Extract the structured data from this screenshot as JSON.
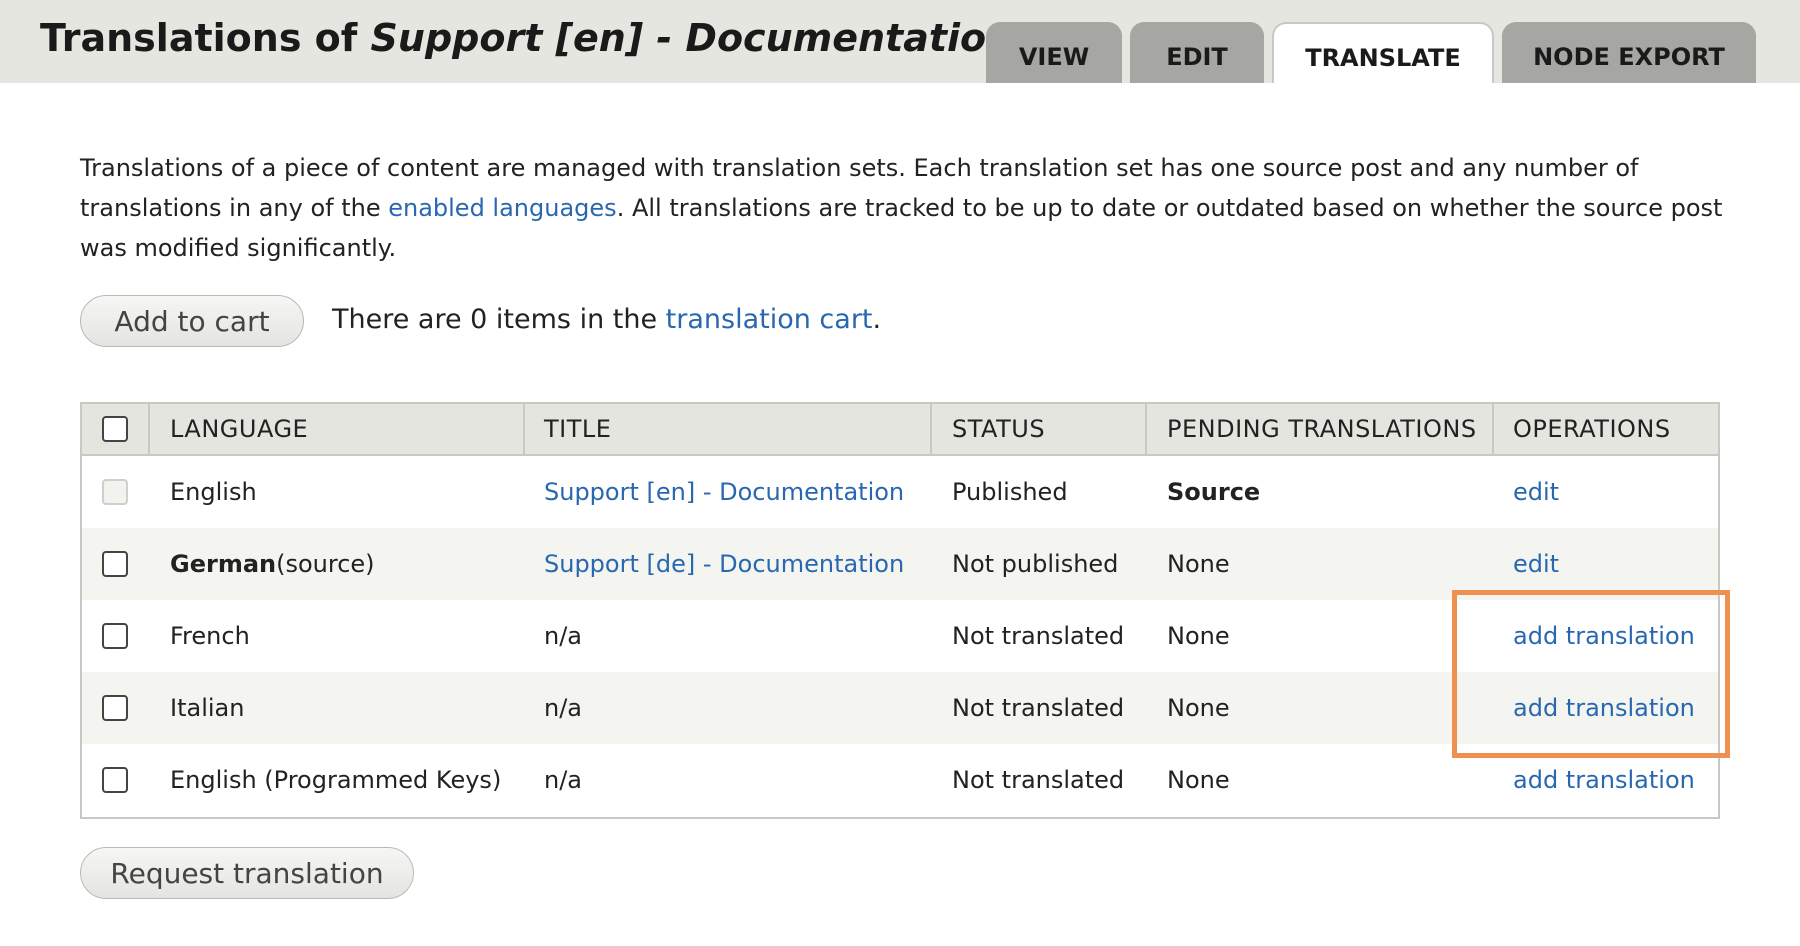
{
  "header": {
    "title_prefix": "Translations of ",
    "title_node": "Support [en] - Documentation",
    "tabs": [
      {
        "label": "VIEW",
        "active": false
      },
      {
        "label": "EDIT",
        "active": false
      },
      {
        "label": "TRANSLATE",
        "active": true
      },
      {
        "label": "NODE EXPORT",
        "active": false
      }
    ]
  },
  "intro": {
    "part1": "Translations of a piece of content are managed with translation sets. Each translation set has one source post and any number of translations in any of the ",
    "link": "enabled languages",
    "part2": ". All translations are tracked to be up to date or outdated based on whether the source post was modified significantly."
  },
  "cart": {
    "button_label": "Add to cart",
    "text_before": "There are 0 items in the ",
    "link": "translation cart",
    "text_after": "."
  },
  "table": {
    "columns": [
      "LANGUAGE",
      "TITLE",
      "STATUS",
      "PENDING TRANSLATIONS",
      "OPERATIONS"
    ],
    "rows": [
      {
        "language": "English",
        "language_suffix": "",
        "title": "Support [en] - Documentation",
        "status": "Published",
        "pending": "Source",
        "operation": "edit"
      },
      {
        "language": "German",
        "language_suffix": " (source)",
        "title": "Support [de] - Documentation",
        "status": "Not published",
        "pending": "None",
        "operation": "edit"
      },
      {
        "language": "French",
        "language_suffix": "",
        "title": "n/a",
        "status": "Not translated",
        "pending": "None",
        "operation": "add translation"
      },
      {
        "language": "Italian",
        "language_suffix": "",
        "title": "n/a",
        "status": "Not translated",
        "pending": "None",
        "operation": "add translation"
      },
      {
        "language": "English (Programmed Keys)",
        "language_suffix": "",
        "title": "n/a",
        "status": "Not translated",
        "pending": "None",
        "operation": "add translation"
      }
    ]
  },
  "request_button_label": "Request translation",
  "colors": {
    "link": "#2968b0",
    "highlight": "#ee9050",
    "header_bg": "#e6e6e1",
    "tab_bg": "#a6a6a3"
  }
}
